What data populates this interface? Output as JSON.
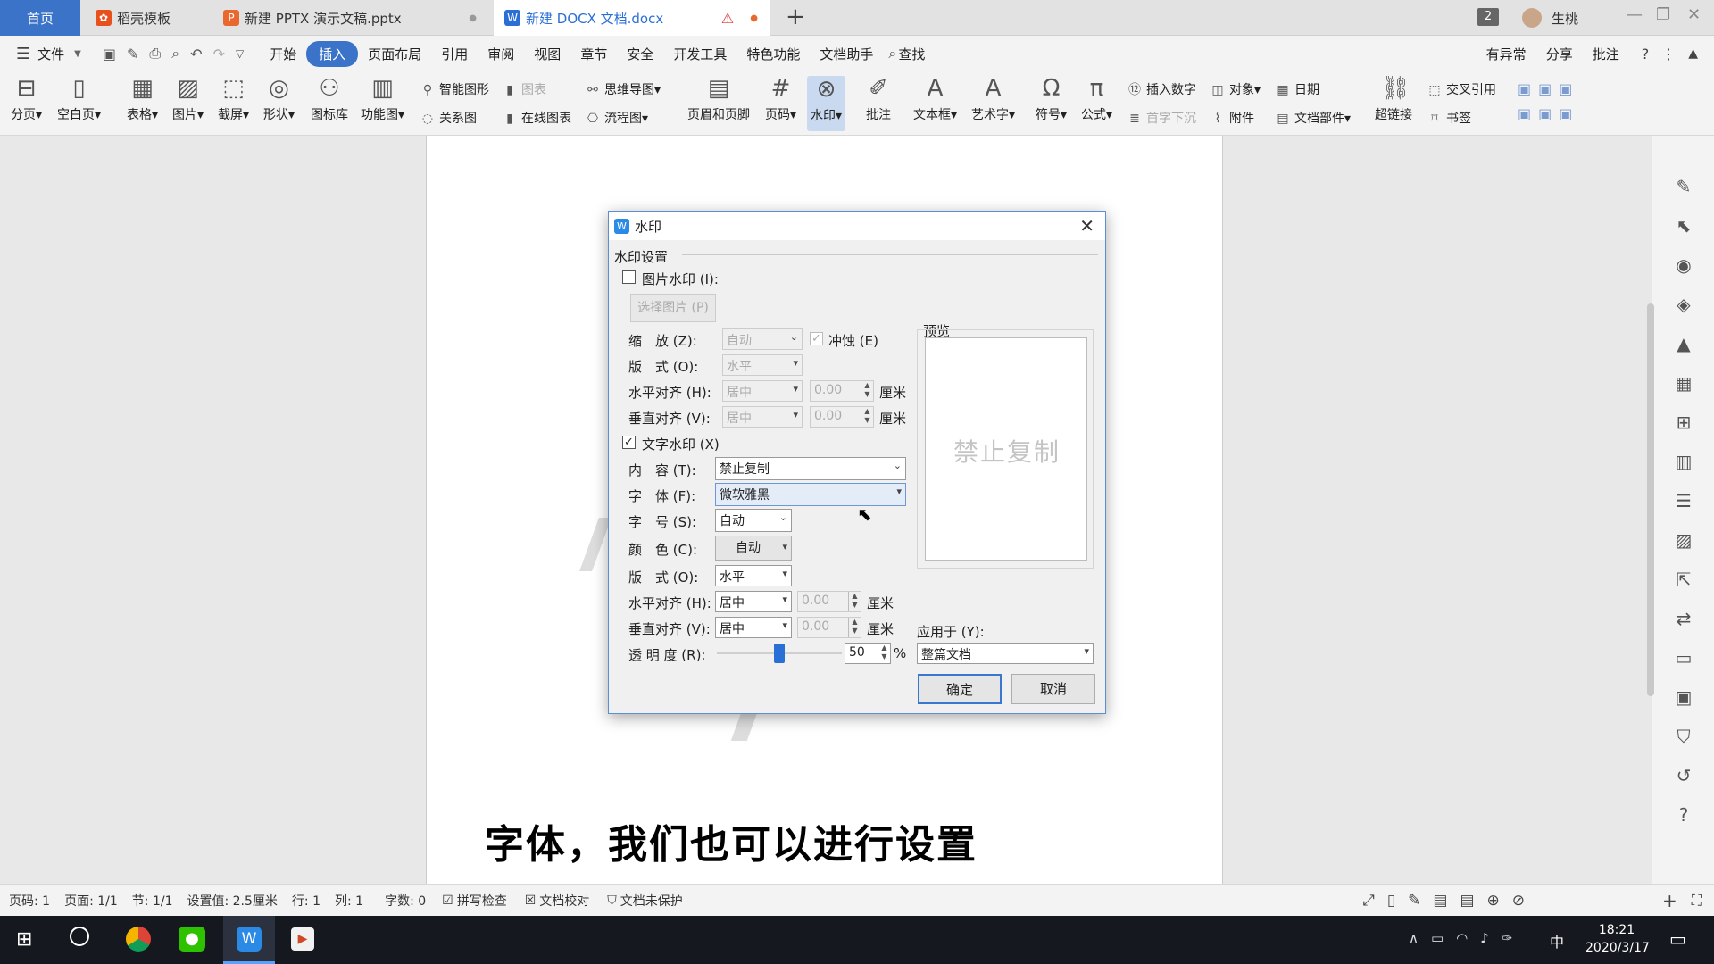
{
  "tabs": {
    "home": "首页",
    "template": "稻壳模板",
    "pptx": "新建 PPTX 演示文稿.pptx",
    "docx": "新建 DOCX 文档.docx",
    "count": "2",
    "user": "生桃"
  },
  "menu": {
    "file": "文件",
    "items": [
      "开始",
      "插入",
      "页面布局",
      "引用",
      "审阅",
      "视图",
      "章节",
      "安全",
      "开发工具",
      "特色功能",
      "文档助手"
    ],
    "search": "查找",
    "right": [
      "有异常",
      "分享",
      "批注"
    ]
  },
  "ribbon": {
    "big": [
      "分页",
      "空白页",
      "表格",
      "图片",
      "截屏",
      "形状",
      "图标库",
      "功能图",
      "页眉和页脚",
      "页码",
      "水印",
      "批注",
      "文本框",
      "艺术字",
      "符号",
      "公式",
      "超链接"
    ],
    "small": [
      "智能图形",
      "图表",
      "思维导图",
      "关系图",
      "在线图表",
      "流程图",
      "插入数字",
      "对象",
      "日期",
      "首字下沉",
      "附件",
      "文档部件",
      "交叉引用",
      "书签"
    ]
  },
  "document": {
    "caption": "字体，我们也可以进行设置"
  },
  "dialog": {
    "title": "水印",
    "section": "水印设置",
    "pic_watermark": "图片水印 (I):",
    "choose_pic": "选择图片 (P)",
    "scale_label": "缩　放 (Z):",
    "scale_value": "自动",
    "washout": "冲蚀 (E)",
    "layout_label": "版　式 (O):",
    "layout_value": "水平",
    "halign_label": "水平对齐 (H):",
    "halign_value": "居中",
    "valign_label": "垂直对齐 (V):",
    "valign_value": "居中",
    "num_zero": "0.00",
    "unit_cm": "厘米",
    "text_watermark": "文字水印 (X)",
    "content_label": "内　容 (T):",
    "content_value": "禁止复制",
    "font_label": "字　体 (F):",
    "font_value": "微软雅黑",
    "size_label": "字　号 (S):",
    "size_value": "自动",
    "color_label": "颜　色 (C):",
    "color_value": "自动",
    "layout2_label": "版　式 (O):",
    "layout2_value": "水平",
    "halign2_label": "水平对齐 (H):",
    "halign2_value": "居中",
    "valign2_label": "垂直对齐 (V):",
    "valign2_value": "居中",
    "opacity_label": "透 明 度 (R):",
    "opacity_value": "50",
    "opacity_fraction": 0.5,
    "percent": "%",
    "preview_label": "预览",
    "preview_text": "禁止复制",
    "apply_label": "应用于 (Y):",
    "apply_value": "整篇文档",
    "ok": "确定",
    "cancel": "取消"
  },
  "status": {
    "page": "页码: 1",
    "pages": "页面: 1/1",
    "section": "节: 1/1",
    "setting": "设置值: 2.5厘米",
    "row": "行: 1",
    "col": "列: 1",
    "words": "字数: 0",
    "spell": "拼写检查",
    "proof": "文档校对",
    "protect": "文档未保护"
  },
  "taskbar": {
    "time": "18:21",
    "date": "2020/3/17",
    "ime": "中"
  },
  "colors": {
    "accent": "#3a73c8",
    "dialog_border": "#5a8fd6"
  }
}
